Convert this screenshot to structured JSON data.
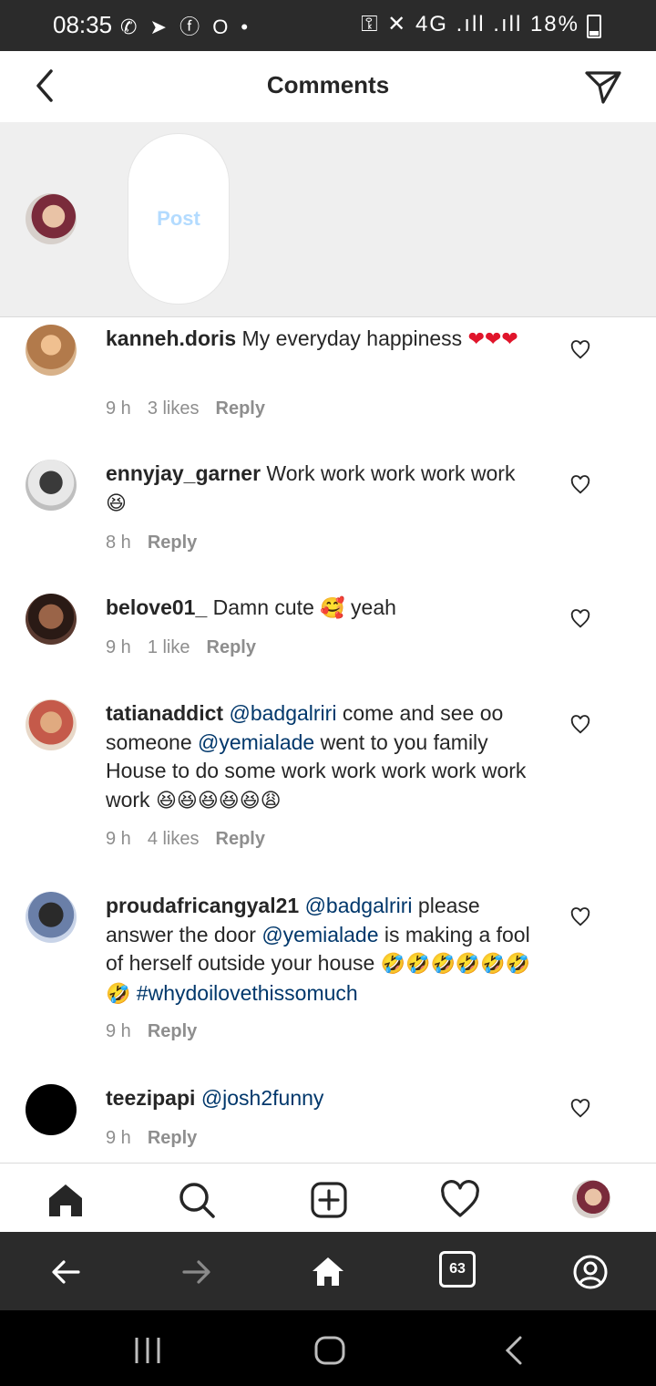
{
  "status_bar": {
    "time": "08:35",
    "app_icons": "✆ ➤ ⓕ O •",
    "right_text": "⚿ ✕ 4G .ıll .ıll 18%"
  },
  "header": {
    "title": "Comments"
  },
  "composer": {
    "post_label": "Post"
  },
  "comments": [
    {
      "username": "kanneh.doris",
      "segments": [
        {
          "text": " My everyday happiness "
        },
        {
          "text": "❤❤❤",
          "emoji": true
        }
      ],
      "time": "9 h",
      "likes": "3 likes",
      "reply": "Reply",
      "avatar_color": "#c8a27a"
    },
    {
      "username": "ennyjay_garner",
      "segments": [
        {
          "text": " Work work work work work "
        },
        {
          "text": "😆",
          "emoji": true
        }
      ],
      "time": "8 h",
      "likes": "",
      "reply": "Reply",
      "avatar_color": "#cfcfcf"
    },
    {
      "username": "belove01_",
      "segments": [
        {
          "text": " Damn cute "
        },
        {
          "text": "🥰",
          "emoji": true
        },
        {
          "text": " yeah"
        }
      ],
      "time": "9 h",
      "likes": "1 like",
      "reply": "Reply",
      "avatar_color": "#6b3b2a"
    },
    {
      "username": "tatianaddict",
      "segments": [
        {
          "text": " "
        },
        {
          "text": "@badgalriri",
          "mention": true
        },
        {
          "text": " come and see oo someone "
        },
        {
          "text": "@yemialade",
          "mention": true
        },
        {
          "text": " went to you family House to do some work work work work work work "
        },
        {
          "text": "😆😆😆😆😆😩",
          "emoji": true
        }
      ],
      "time": "9 h",
      "likes": "4 likes",
      "reply": "Reply",
      "avatar_color": "#d49a7a"
    },
    {
      "username": "proudafricangyal21",
      "segments": [
        {
          "text": " "
        },
        {
          "text": "@badgalriri",
          "mention": true
        },
        {
          "text": " please answer the door "
        },
        {
          "text": "@yemialade",
          "mention": true
        },
        {
          "text": " is making a fool of herself outside your house "
        },
        {
          "text": "🤣🤣🤣🤣🤣🤣🤣",
          "emoji": true
        },
        {
          "text": " "
        },
        {
          "text": "#whydoilovethissomuch",
          "mention": true
        }
      ],
      "time": "9 h",
      "likes": "",
      "reply": "Reply",
      "avatar_color": "#3a4a6a"
    },
    {
      "username": "teezipapi",
      "segments": [
        {
          "text": " "
        },
        {
          "text": "@josh2funny",
          "mention": true
        }
      ],
      "time": "9 h",
      "likes": "",
      "reply": "Reply",
      "avatar_color": "#000000"
    }
  ],
  "browser_bar": {
    "tab_count": "63"
  },
  "icons": {
    "header": [
      "back-arrow-icon",
      "direct-send-icon"
    ],
    "tabbar": [
      "home-icon",
      "search-icon",
      "new-post-icon",
      "activity-heart-icon",
      "profile-avatar"
    ],
    "browser": [
      "back-icon",
      "forward-icon",
      "home-icon",
      "tabs-icon",
      "account-icon"
    ],
    "system": [
      "recents-icon",
      "home-icon",
      "back-icon"
    ]
  }
}
